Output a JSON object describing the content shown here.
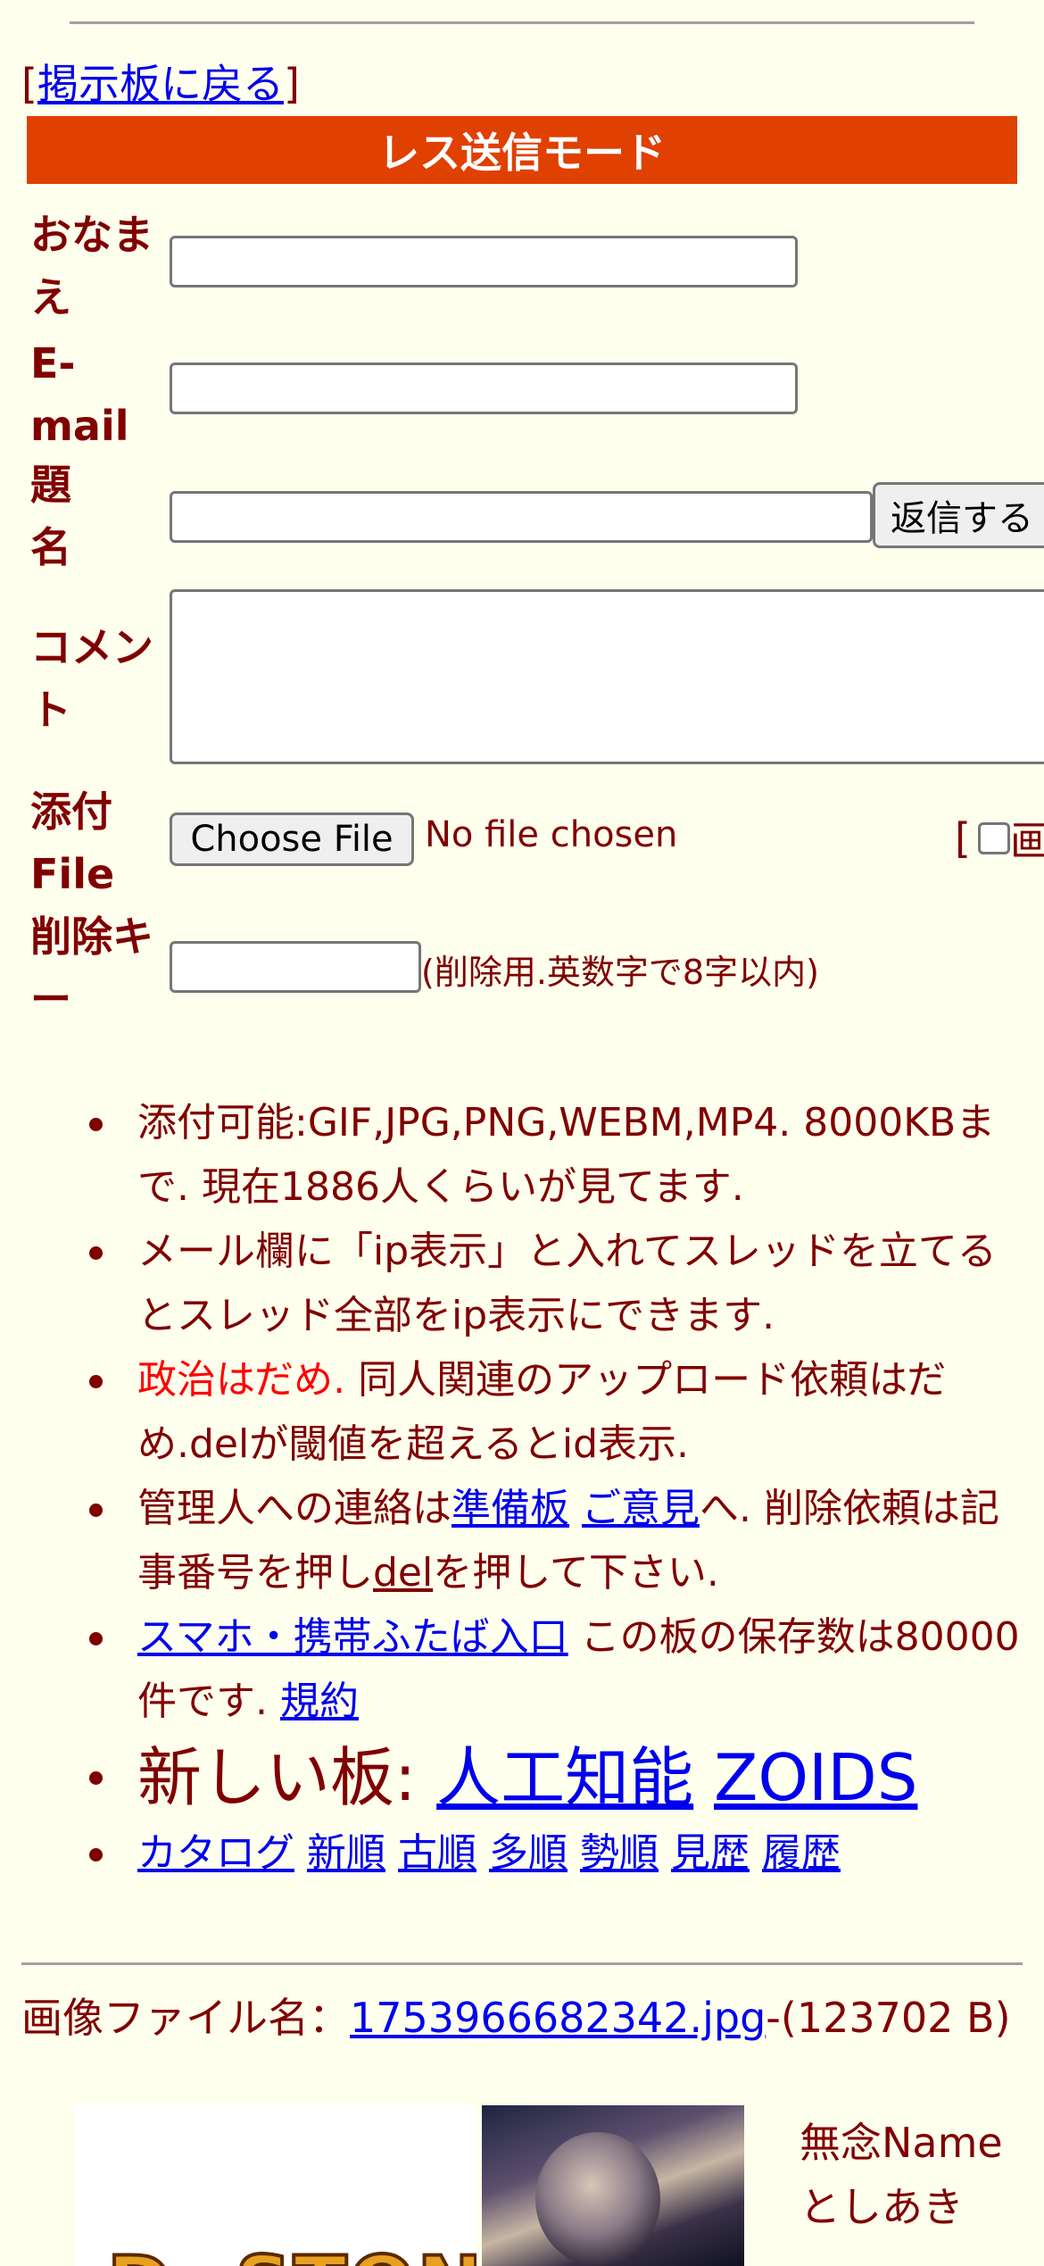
{
  "nav": {
    "back_link": "掲示板に戻る"
  },
  "form": {
    "mode_title": "レス送信モード",
    "name_label": "おなまえ",
    "email_label": "E-mail",
    "subject_label": "題名",
    "comment_label": "コメント",
    "file_label": "添付File",
    "delkey_label": "削除キー",
    "submit_label": "返信する",
    "choose_file_label": "Choose File",
    "no_file_text": "No file chosen",
    "delkey_hint": "(削除用.英数字で8字以内)",
    "image_checkbox_partial": "画"
  },
  "rules": {
    "r1": "添付可能:GIF,JPG,PNG,WEBM,MP4. 8000KBまで. 現在1886人くらいが見てます.",
    "r2": "メール欄に「ip表示」と入れてスレッドを立てるとスレッド全部をip表示にできます.",
    "r3_red": "政治はだめ.",
    "r3_rest": " 同人関連のアップロード依頼はだめ.delが閾値を超えるとid表示.",
    "r4_pre": "管理人への連絡は",
    "r4_link1": "準備板",
    "r4_link2": "ご意見",
    "r4_mid": "へ. 削除依頼は記事番号を押し",
    "r4_link3": "del",
    "r4_post": "を押して下さい.",
    "r5_link": "スマホ・携帯ふたば入口",
    "r5_mid": " この板の保存数は80000件です. ",
    "r5_link2": "規約",
    "r6_label": "新しい板: ",
    "r6_link1": "人工知能",
    "r6_link2": "ZOIDS",
    "r7_links": [
      "カタログ",
      "新順",
      "古順",
      "多順",
      "勢順",
      "見歴",
      "履歴"
    ]
  },
  "post": {
    "file_prefix": "画像ファイル名：",
    "file_name": "1753966682342.jpg",
    "file_size": "-(123702 B)",
    "thumb_logo_text": "Dr.STONE",
    "name_line1": "無念Name",
    "name_line2": "としあき"
  },
  "colors": {
    "background": "#ffffee",
    "text": "#800000",
    "mode_bar": "#e04000",
    "link": "#0000ee",
    "warning": "#ff0000"
  }
}
